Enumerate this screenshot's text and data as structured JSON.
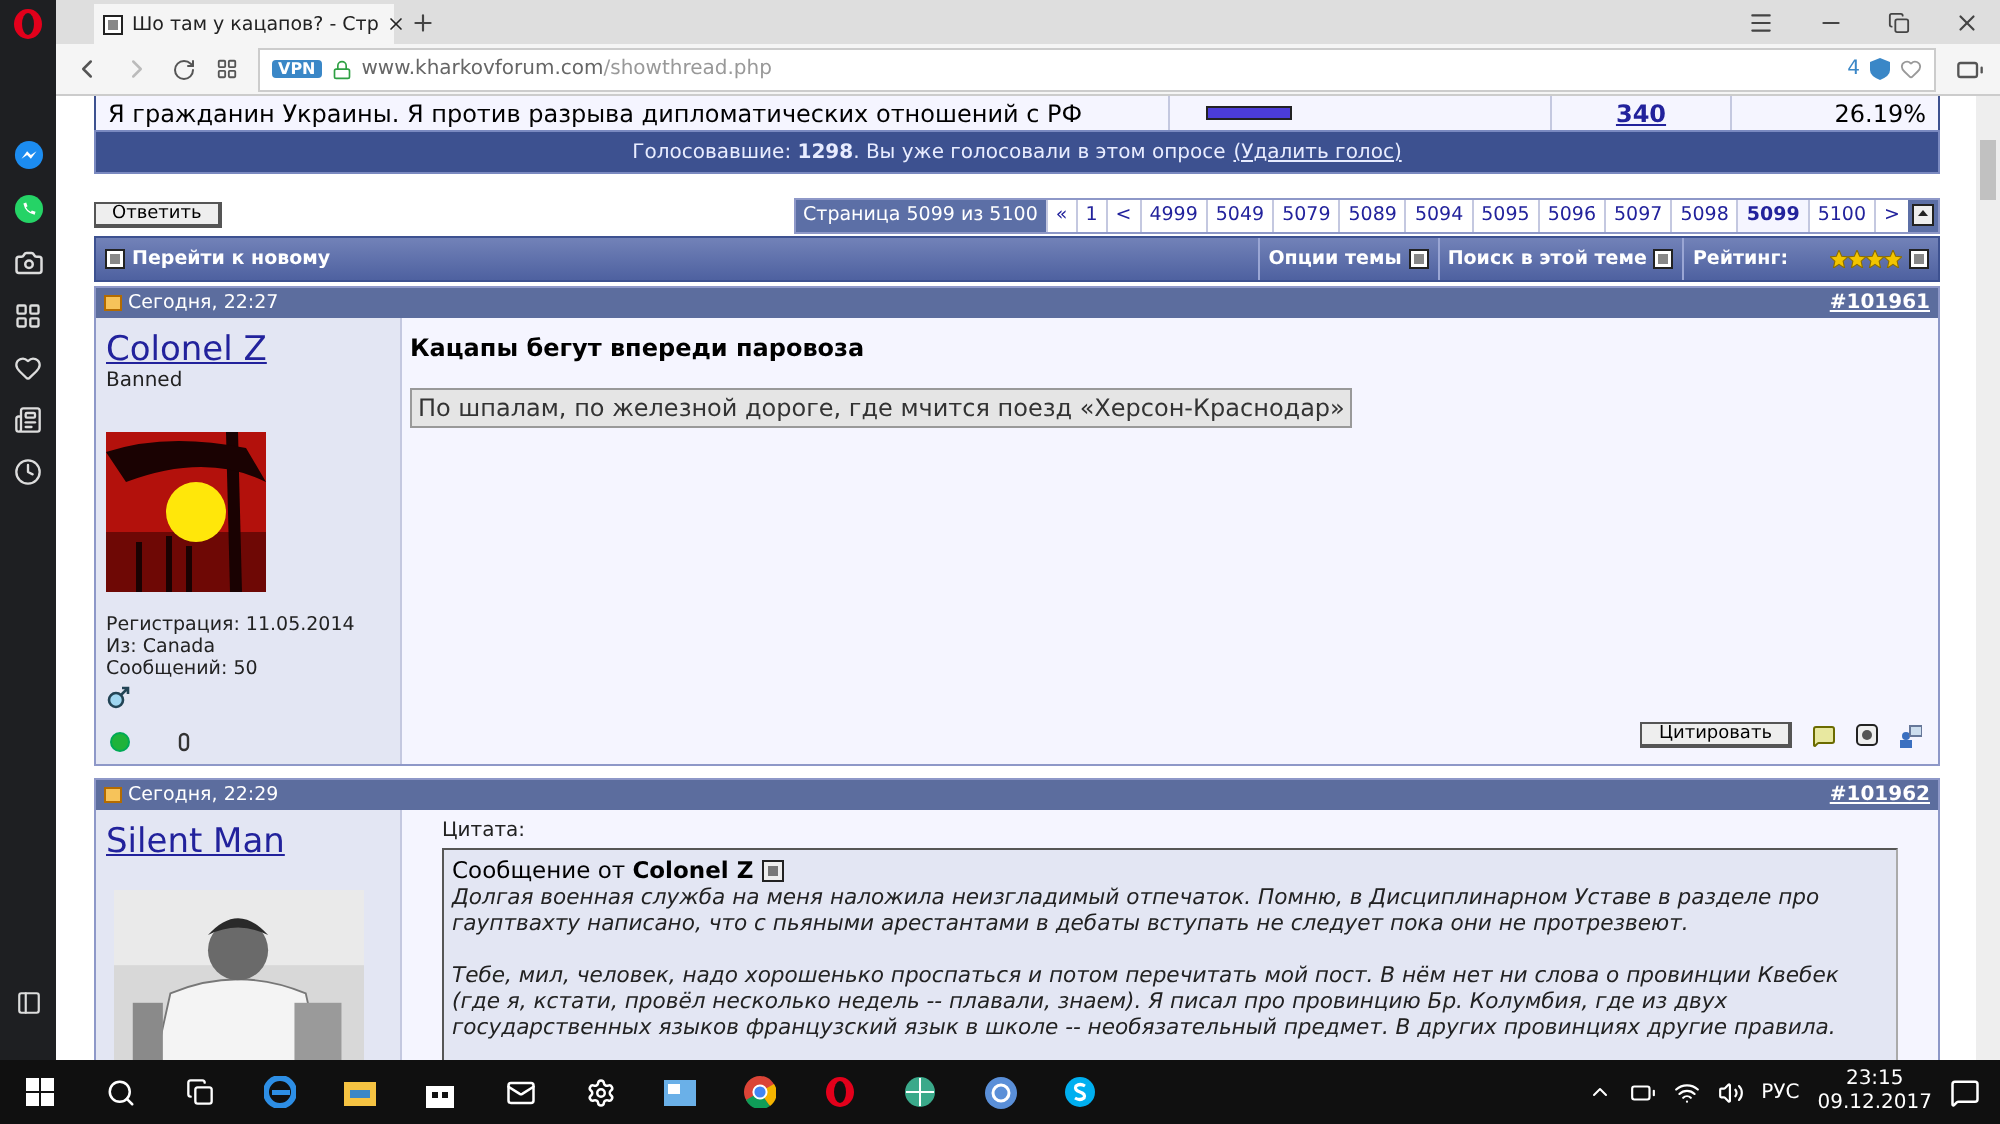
{
  "browser": {
    "tab_title": "Шо там у кацапов? - Стр",
    "url_host": "www.kharkovforum.com",
    "url_path": "/showthread.php",
    "vpn": "VPN",
    "blocked_count": "4"
  },
  "poll": {
    "option": "Я гражданин Украины. Я против разрыва дипломатических отношений с РФ",
    "level": 0.26,
    "votes": "340",
    "percent": "26.19%",
    "voters_text": "Голосовавшие: **1298**. Вы уже голосовали в этом опросе",
    "remove_vote": "(Удалить голос)"
  },
  "reply_button": "Ответить",
  "pagination": {
    "label": "Страница 5099 из 5100",
    "pages": [
      {
        "text": "«",
        "selected": false
      },
      {
        "text": "1",
        "selected": false
      },
      {
        "text": "<",
        "selected": false
      },
      {
        "text": "4999",
        "selected": false
      },
      {
        "text": "5049",
        "selected": false
      },
      {
        "text": "5079",
        "selected": false
      },
      {
        "text": "5089",
        "selected": false
      },
      {
        "text": "5094",
        "selected": false
      },
      {
        "text": "5095",
        "selected": false
      },
      {
        "text": "5096",
        "selected": false
      },
      {
        "text": "5097",
        "selected": false
      },
      {
        "text": "5098",
        "selected": false
      },
      {
        "text": "5099",
        "selected": true
      },
      {
        "text": "5100",
        "selected": false
      },
      {
        "text": ">",
        "selected": false
      }
    ]
  },
  "thread_tools": {
    "go_new": "Перейти к новому",
    "options": "Опции темы",
    "search": "Поиск в этой теме",
    "rating_label": "Рейтинг:",
    "stars": 4
  },
  "posts": [
    {
      "time": "Сегодня, 22:27",
      "number": "#101961",
      "username": "Colonel Z",
      "rank": "Banned",
      "details": [
        "Регистрация: 11.05.2014",
        "Из: Canada",
        "Сообщений: 50"
      ],
      "online": true,
      "title": "Кацапы бегут впереди паровоза",
      "body_box": "По шпалам, по железной дороге, где мчится поезд «Херсон-Краснодар»",
      "quote_button": "Цитировать"
    },
    {
      "time": "Сегодня, 22:29",
      "number": "#101962",
      "username": "Silent Man",
      "quote": {
        "label": "Цитата:",
        "author_prefix": "Сообщение от",
        "author": "Colonel Z",
        "paragraphs": [
          "Долгая военная служба на меня наложила неизгладимый отпечаток. Помню, в Дисциплинарном Уставе в разделе про гауптвахту написано, что с пьяными арестантами в дебаты вступать не следует пока они не протрезвеют.",
          "Тебе, мил, человек, надо хорошенько проспаться и потом перечитать мой пост. В нём нет ни слова о провинции Квебек (где я, кстати, провёл несколько недель -- плавали, знаем). Я писал про провинцию Бр. Колумбия, где из двух государственных языков французский язык в школе -- необязательный предмет. В других провинциях другие правила."
        ]
      }
    }
  ],
  "taskbar": {
    "language": "РУС",
    "time": "23:15",
    "date": "09.12.2017"
  }
}
